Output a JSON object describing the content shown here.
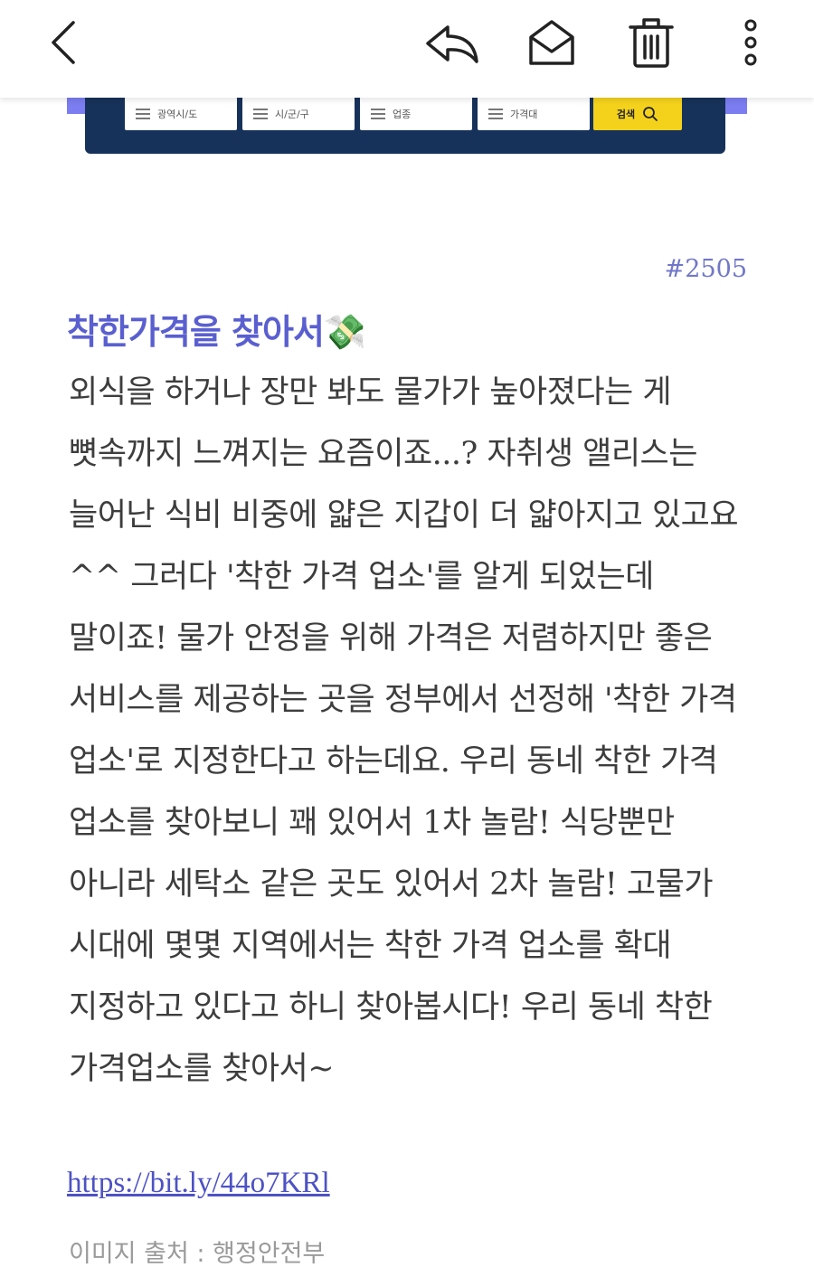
{
  "toolbar": {
    "back_icon": "chevron-left-icon",
    "reply_icon": "reply-icon",
    "mark_unread_icon": "envelope-open-icon",
    "delete_icon": "trash-icon",
    "more_icon": "more-vertical-icon"
  },
  "banner": {
    "filters": [
      "광역시/도",
      "시/군/구",
      "업종",
      "가격대"
    ],
    "search_label": "검색"
  },
  "post": {
    "number": "#2505",
    "title": "착한가격을 찾아서💸",
    "body": "외식을 하거나 장만 봐도 물가가 높아졌다는 게 뼛속까지 느껴지는 요즘이죠...? 자취생 앨리스는 늘어난 식비 비중에 얇은 지갑이 더 얇아지고 있고요^^ 그러다 '착한 가격 업소'를 알게 되었는데 말이죠! 물가 안정을 위해 가격은 저렴하지만 좋은 서비스를 제공하는 곳을 정부에서 선정해 '착한 가격 업소'로 지정한다고 하는데요. 우리 동네 착한 가격 업소를 찾아보니 꽤 있어서 1차 놀람! 식당뿐만 아니라 세탁소 같은 곳도 있어서 2차 놀람! 고물가 시대에 몇몇 지역에서는 착한 가격 업소를 확대 지정하고 있다고 하니 찾아봅시다! 우리 동네 착한 가격업소를 찾아서~",
    "link": "https://bit.ly/44o7KRl",
    "source": "이미지 출처 : 행정안전부"
  },
  "colors": {
    "accent": "#5a5fd0",
    "banner_navy": "#17325a",
    "banner_strip": "#7b7df0",
    "search_yellow": "#f4d21c"
  }
}
